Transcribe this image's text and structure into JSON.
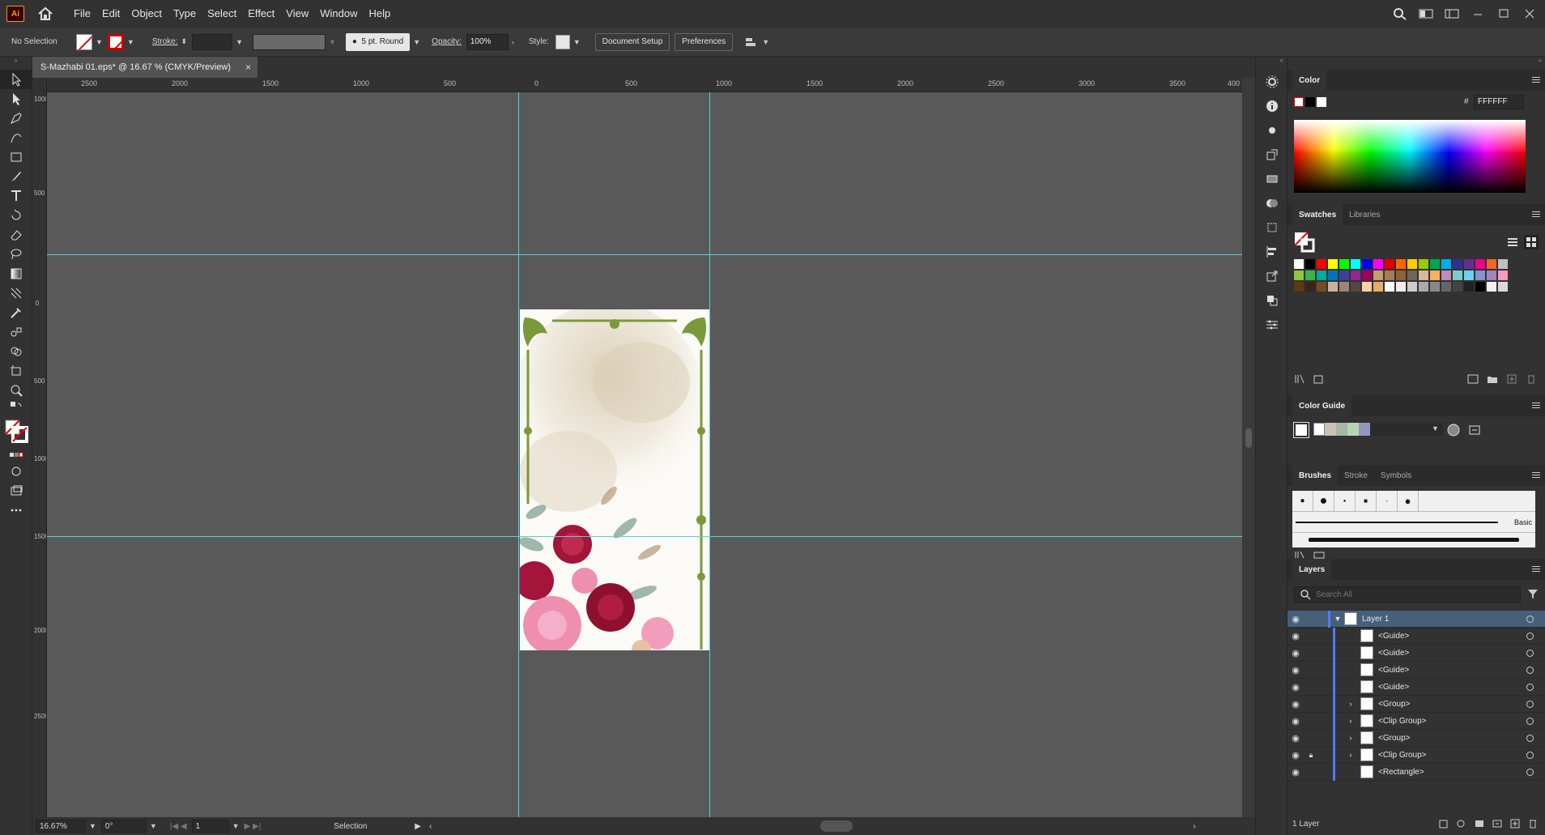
{
  "app": {
    "logo_text": "Ai"
  },
  "menu": [
    "File",
    "Edit",
    "Object",
    "Type",
    "Select",
    "Effect",
    "View",
    "Window",
    "Help"
  ],
  "control": {
    "selection_label": "No Selection",
    "stroke_label": "Stroke:",
    "brush_profile": "5 pt. Round",
    "opacity_label": "Opacity:",
    "opacity_value": "100%",
    "style_label": "Style:",
    "document_setup": "Document Setup",
    "preferences": "Preferences"
  },
  "document": {
    "tab_title": "S-Mazhabi 01.eps* @ 16.67 % (CMYK/Preview)",
    "close": "×"
  },
  "ruler": {
    "h_ticks": [
      "2500",
      "2000",
      "1500",
      "1000",
      "500",
      "0",
      "500",
      "1000",
      "1500",
      "2000",
      "2500",
      "3000",
      "3500",
      "400"
    ],
    "v_ticks": [
      "1000",
      "500",
      "0",
      "500",
      "1000",
      "1500",
      "2000",
      "2500"
    ]
  },
  "status": {
    "zoom": "16.67%",
    "rotate": "0°",
    "artboard": "1",
    "tool": "Selection"
  },
  "panels": {
    "color": {
      "title": "Color",
      "hex_label": "#",
      "hex_value": "FFFFFF"
    },
    "swatches": {
      "tab_swatches": "Swatches",
      "tab_libraries": "Libraries"
    },
    "color_guide": {
      "title": "Color Guide"
    },
    "brushes": {
      "tab_brushes": "Brushes",
      "tab_stroke": "Stroke",
      "tab_symbols": "Symbols",
      "basic_label": "Basic"
    },
    "layers": {
      "title": "Layers",
      "search_placeholder": "Search All",
      "items": [
        {
          "name": "Layer 1",
          "indent": 0,
          "expand": "open"
        },
        {
          "name": "<Guide>",
          "indent": 1,
          "expand": ""
        },
        {
          "name": "<Guide>",
          "indent": 1,
          "expand": ""
        },
        {
          "name": "<Guide>",
          "indent": 1,
          "expand": ""
        },
        {
          "name": "<Guide>",
          "indent": 1,
          "expand": ""
        },
        {
          "name": "<Group>",
          "indent": 1,
          "expand": "closed"
        },
        {
          "name": "<Clip Group>",
          "indent": 1,
          "expand": "closed"
        },
        {
          "name": "<Group>",
          "indent": 1,
          "expand": "closed"
        },
        {
          "name": "<Clip Group>",
          "indent": 1,
          "expand": "closed",
          "locked": true
        },
        {
          "name": "<Rectangle>",
          "indent": 1,
          "expand": ""
        }
      ],
      "count_label": "1 Layer"
    }
  },
  "colors": {
    "guide": "#4fd3d8",
    "accent_layer": "#4f7cff",
    "frame_green": "#7a9a3a",
    "rose_dark": "#a3153a",
    "rose_pink": "#ee8fb0"
  },
  "swatch_colors": [
    "#ffffff",
    "#000000",
    "#ff0000",
    "#ffff00",
    "#00ff00",
    "#00ffff",
    "#0000ff",
    "#ff00ff",
    "#e00000",
    "#ff6600",
    "#ffcc00",
    "#99cc00",
    "#00a651",
    "#00aeef",
    "#2e3192",
    "#662d91",
    "#ec008c",
    "#f26522",
    "#c0c0c0",
    "#8dc63f",
    "#39b54a",
    "#00a99d",
    "#0072bc",
    "#3d4097",
    "#92278f",
    "#9e005d",
    "#c69c6d",
    "#a67c52",
    "#8c6239",
    "#736357",
    "#d7b89c",
    "#fbaf5d",
    "#bd8cbf",
    "#7accc8",
    "#6dcff6",
    "#8493ca",
    "#a186be",
    "#f49ac1",
    "#603913",
    "#3c2415",
    "#754c24",
    "#c7b299",
    "#998675",
    "#534741",
    "#fdd0a2",
    "#e7ad6a",
    "#ffffff",
    "#eeeeee",
    "#cccccc",
    "#aaaaaa",
    "#888888",
    "#666666",
    "#444444",
    "#222222",
    "#000000",
    "#f0f0f0",
    "#d9d9d9"
  ]
}
